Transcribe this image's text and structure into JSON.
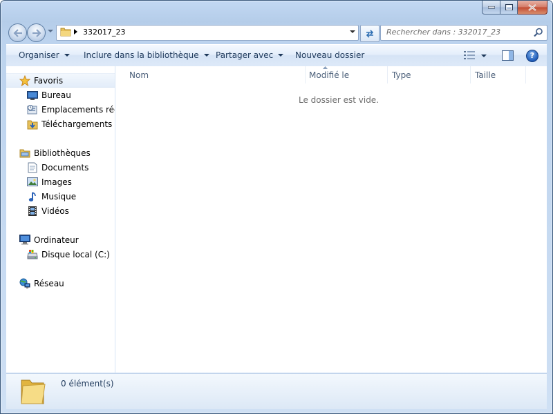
{
  "window": {
    "caption": {
      "minimize_icon": "minimize-icon",
      "maximize_icon": "maximize-icon",
      "close_icon": "close-icon"
    }
  },
  "navbar": {
    "address_path": "332017_23",
    "search_placeholder": "Rechercher dans : 332017_23"
  },
  "commands": {
    "organize": "Organiser",
    "include_library": "Inclure dans la bibliothèque",
    "share_with": "Partager avec",
    "new_folder": "Nouveau dossier"
  },
  "help_label": "?",
  "sidebar": {
    "favorites": {
      "label": "Favoris",
      "items": [
        {
          "label": "Bureau",
          "icon": "desktop-icon"
        },
        {
          "label": "Emplacements récents",
          "icon": "recent-places-icon"
        },
        {
          "label": "Téléchargements",
          "icon": "downloads-icon"
        }
      ]
    },
    "libraries": {
      "label": "Bibliothèques",
      "items": [
        {
          "label": "Documents",
          "icon": "documents-icon"
        },
        {
          "label": "Images",
          "icon": "pictures-icon"
        },
        {
          "label": "Musique",
          "icon": "music-icon"
        },
        {
          "label": "Vidéos",
          "icon": "videos-icon"
        }
      ]
    },
    "computer": {
      "label": "Ordinateur",
      "items": [
        {
          "label": "Disque local (C:)",
          "icon": "drive-icon"
        }
      ]
    },
    "network": {
      "label": "Réseau"
    }
  },
  "filelist": {
    "columns": [
      "Nom",
      "Modifié le",
      "Type",
      "Taille"
    ],
    "empty_message": "Le dossier est vide."
  },
  "details": {
    "count": "0 élément(s)"
  },
  "colors": {
    "accent_text": "#1e395b",
    "frame": "#c2d8f3"
  }
}
